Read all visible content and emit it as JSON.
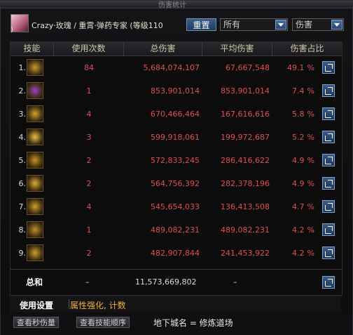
{
  "window": {
    "title": "伤害统计"
  },
  "header": {
    "character": "Crazy·玫瑰 / 重霄·弹药专家 (等级110",
    "character_paren": ")",
    "reset_label": "重置",
    "filter_scope": "所有",
    "filter_metric": "伤害"
  },
  "table": {
    "columns": [
      "技能",
      "使用次数",
      "总伤害",
      "平均伤害",
      "伤害占比"
    ],
    "rows": [
      {
        "rank": "1.",
        "icon": "skill-icon-1",
        "uses": "84",
        "total": "5,684,074,107",
        "avg": "67,667,548",
        "pct": "49.1",
        "pct_sign": "%"
      },
      {
        "rank": "2.",
        "icon": "skill-icon-2",
        "uses": "1",
        "total": "853,901,014",
        "avg": "853,901,014",
        "pct": "7.4",
        "pct_sign": "%"
      },
      {
        "rank": "3.",
        "icon": "skill-icon-3",
        "uses": "4",
        "total": "670,466,464",
        "avg": "167,616,616",
        "pct": "5.8",
        "pct_sign": "%"
      },
      {
        "rank": "4.",
        "icon": "skill-icon-4",
        "uses": "3",
        "total": "599,918,061",
        "avg": "199,972,687",
        "pct": "5.2",
        "pct_sign": "%"
      },
      {
        "rank": "5.",
        "icon": "skill-icon-5",
        "uses": "2",
        "total": "572,833,245",
        "avg": "286,416,622",
        "pct": "4.9",
        "pct_sign": "%"
      },
      {
        "rank": "6.",
        "icon": "skill-icon-6",
        "uses": "2",
        "total": "564,756,392",
        "avg": "282,378,196",
        "pct": "4.9",
        "pct_sign": "%"
      },
      {
        "rank": "7.",
        "icon": "skill-icon-7",
        "uses": "4",
        "total": "545,654,033",
        "avg": "136,413,508",
        "pct": "4.7",
        "pct_sign": "%"
      },
      {
        "rank": "8.",
        "icon": "skill-icon-8",
        "uses": "1",
        "total": "489,082,231",
        "avg": "489,082,231",
        "pct": "4.2",
        "pct_sign": "%"
      },
      {
        "rank": "9.",
        "icon": "skill-icon-9",
        "uses": "2",
        "total": "482,907,844",
        "avg": "241,453,922",
        "pct": "4.2",
        "pct_sign": "%"
      }
    ],
    "sum": {
      "label": "总和",
      "uses": "–",
      "total": "11,573,669,802",
      "avg": "–"
    }
  },
  "bottom_tabs": {
    "settings": "使用设置",
    "attributes": "属性强化, 计数"
  },
  "footer": {
    "btn_view_dps": "查看秒伤量",
    "btn_view_order": "查看技能顺序",
    "dungeon": "地下城名 = 修炼道场"
  },
  "colors": {
    "value_red": "#e05050",
    "accent_blue": "#3d5e88",
    "tab_gold": "#f0b040"
  }
}
